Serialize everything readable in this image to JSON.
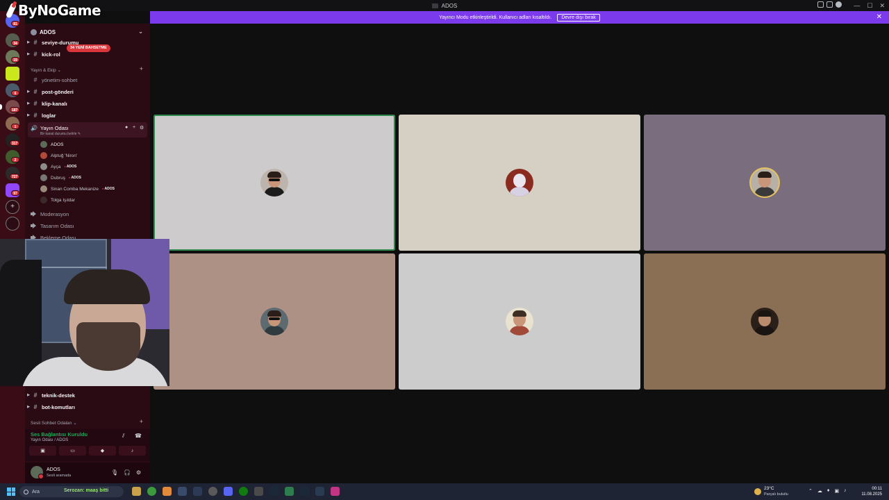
{
  "window": {
    "title": "ADOS"
  },
  "logo": {
    "text": "ByNoGame"
  },
  "banner": {
    "message": "Yayıncı Modu etkinleştirildi. Kullanıcı adları kısaltıldı.",
    "button_label": "Devre dışı bırak",
    "close": "✕",
    "color": "#7c3aed"
  },
  "rail": {
    "badges": [
      "81",
      "34",
      "19",
      "6",
      "187",
      "1",
      "317",
      "2",
      "727",
      "97"
    ]
  },
  "server": {
    "name": "ADOS"
  },
  "channels": {
    "top": [
      {
        "name": "seviye-durumu"
      },
      {
        "name": "kick-rol"
      }
    ],
    "mention_pill": "34 YENİ BAHSETME",
    "category_yayin": "Yayın & Ekip",
    "yayin_channels": [
      {
        "name": "yönetim-sohbet"
      },
      {
        "name": "post-gönderi"
      },
      {
        "name": "klip-kanalı"
      },
      {
        "name": "loglar"
      }
    ],
    "active_voice": {
      "name": "Yayın Odası",
      "status": "Bir kanal durumu belirle ✎"
    },
    "voice_users": [
      {
        "name": "ADOS",
        "live": ""
      },
      {
        "name": "Alptuğ 'Niron'",
        "live": ""
      },
      {
        "name": "Ayça",
        "live": "ADOS"
      },
      {
        "name": "Dubruş",
        "live": "ADOS"
      },
      {
        "name": "Sinan Comba Mekanize",
        "live": "ADOS"
      },
      {
        "name": "Tolga Işıldar",
        "live": ""
      }
    ],
    "voice_rooms": [
      {
        "name": "Moderasyon"
      },
      {
        "name": "Tasarım Odası"
      },
      {
        "name": "Bekleme Odası"
      }
    ],
    "bottom": [
      {
        "name": "teknik-destek"
      },
      {
        "name": "bot-komutları"
      }
    ],
    "category_sesli": "Sesli Sohbet Odaları"
  },
  "voice_panel": {
    "connected": "Ses Bağlantısı Kuruldu",
    "location": "Yayın Odası / ADOS"
  },
  "user_panel": {
    "name": "ADOS",
    "status": "Sesli aramada"
  },
  "tiles": [
    {
      "color": "#cdcbcb",
      "speaking": true
    },
    {
      "color": "#d6d0c4",
      "speaking": false
    },
    {
      "color": "#7a6e7e",
      "speaking": false
    },
    {
      "color": "#ae9185",
      "speaking": false
    },
    {
      "color": "#cccccc",
      "speaking": false
    },
    {
      "color": "#8a6f55",
      "speaking": false
    }
  ],
  "taskbar": {
    "search_placeholder": "Ara",
    "ticker": "Serozan: maaş bitti",
    "weather_temp": "23°C",
    "weather_desc": "Parçalı bulutlu",
    "time": "00:11",
    "date": "11.08.2025"
  }
}
